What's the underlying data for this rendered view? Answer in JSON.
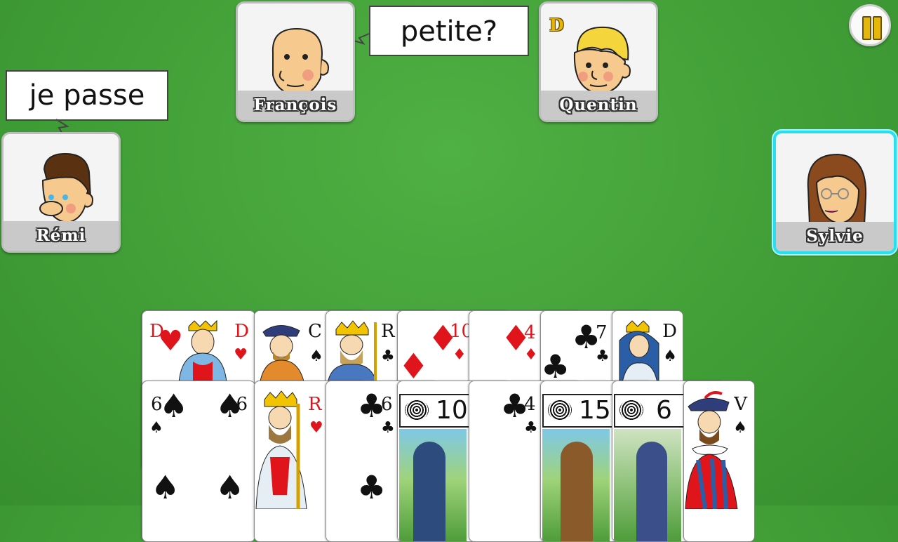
{
  "players": [
    {
      "name": "Rémi",
      "face": "player-face-icon",
      "speech": "je passe"
    },
    {
      "name": "François",
      "face": "player-face-icon",
      "speech": "petite?"
    },
    {
      "name": "Quentin",
      "face": "player-face-icon",
      "dealer_badge": "D"
    },
    {
      "name": "Sylvie",
      "face": "player-face-icon",
      "active": true
    }
  ],
  "pause_button": {
    "icon": "pause-icon"
  },
  "hand": {
    "back_row": [
      {
        "rank": "D",
        "suit": "♥",
        "kind": "queen of hearts"
      },
      {
        "rank": "C",
        "suit": "♠",
        "kind": "knight of spades"
      },
      {
        "rank": "R",
        "suit": "♣",
        "kind": "king of clubs"
      },
      {
        "rank": "10",
        "suit": "♦",
        "kind": "10 of diamonds"
      },
      {
        "rank": "4",
        "suit": "♦",
        "kind": "4 of diamonds"
      },
      {
        "rank": "7",
        "suit": "♣",
        "kind": "7 of clubs"
      },
      {
        "rank": "D",
        "suit": "♠",
        "kind": "queen of spades"
      }
    ],
    "front_row": [
      {
        "rank": "6",
        "suit": "♠",
        "kind": "6 of spades"
      },
      {
        "rank": "R",
        "suit": "♥",
        "kind": "king of hearts"
      },
      {
        "rank": "6",
        "suit": "♣",
        "kind": "6 of clubs"
      },
      {
        "rank": "10",
        "suit": "trump",
        "kind": "trump 10"
      },
      {
        "rank": "4",
        "suit": "♣",
        "kind": "4 of clubs"
      },
      {
        "rank": "15",
        "suit": "trump",
        "kind": "trump 15"
      },
      {
        "rank": "6",
        "suit": "trump",
        "kind": "trump 6"
      },
      {
        "rank": "V",
        "suit": "♠",
        "kind": "jack of spades"
      }
    ]
  },
  "colors": {
    "table": "#45a63b",
    "highlight": "#27e0ef",
    "suit_red": "#e0141b",
    "dealer": "#e8b400"
  }
}
